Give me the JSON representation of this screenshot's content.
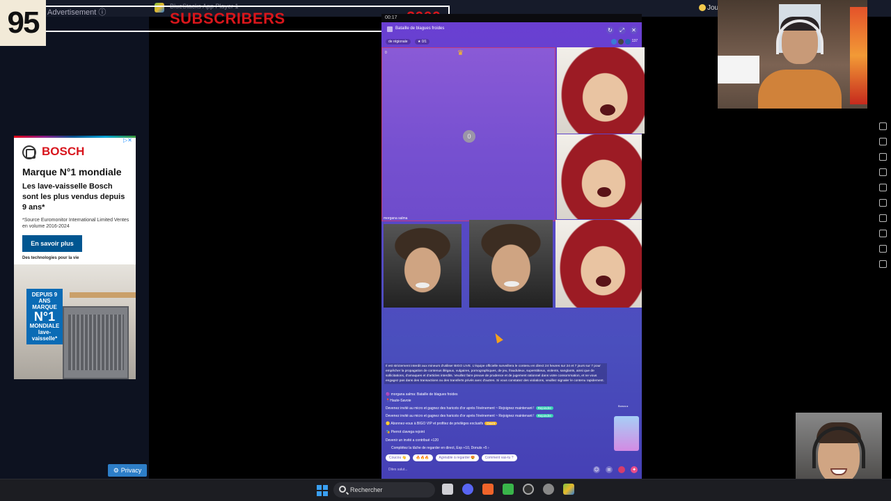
{
  "overlay": {
    "counter": "95",
    "advertisement_label": "Advertisement ⓘ",
    "subscribers_label": "SUBSCRIBERS",
    "subscribers_goal": "2000"
  },
  "topbar": {
    "bluestacks_title": "BlueStacks App Player 1",
    "right_label": "Jou"
  },
  "ad": {
    "brand": "BOSCH",
    "headline": "Marque N°1 mondiale",
    "body": "Les lave-vaisselle Bosch sont les plus vendus depuis 9 ans*",
    "footnote": "*Source Euromonitor International Limited Ventes en volume 2016-2024",
    "cta": "En savoir plus",
    "tagline": "Des technologies pour la vie",
    "badge_top": "DEPUIS 9 ANS MARQUE",
    "badge_big": "N°1",
    "badge_bottom": "MONDIALE lave-vaisselle*",
    "privacy": "Privacy"
  },
  "app": {
    "time": "00:17",
    "room_title": "Bataille de blagues froides",
    "tag_region": "de régionale",
    "tag_seats": "0/1",
    "viewer_count": "137",
    "score": "0",
    "seat_number": "0",
    "host_name": "morgana salma",
    "notice": "Il est strictement interdit aux mineurs d'utiliser BIGO LIVE. L'équipe officielle surveillera le contenu en direct 24 heures sur 24 et 7 jours sur 7 pour empêcher la propagation de contenus illégaux, vulgaires, pornographiques, de jeu, frauduleux, superstitieux, violents, sanglants, ainsi que de sollicitations, d'arnaques et d'articles interdits. Veuillez faire preuve de prudence et de jugement rationnel dans votre consommation, et ne vous engagez pas dans des transactions ou des transferts privés avec d'autres. Si vous constatez des violations, veuillez signaler le contenu rapidement.",
    "chat": [
      "morgana salma: Bataille de blagues froides",
      "Haute-Savoie",
      "Devenez invité au micro et gagnez des haricots d'or après l'événement ~ Rejoignez maintenant !",
      "Devenez invité au micro et gagnez des haricots d'or après l'événement ~ Rejoignez maintenant !",
      "Abonnez-vous à BIGO VIP et profitez de privilèges exclusifs",
      "Pierrot clavega rejoint",
      "Devenir un invité a contribué +120",
      "Complétez la tâche de regarder en direct, Exp +10, Donuts +5"
    ],
    "quick_replies": [
      "Coucou 👋",
      "🔥🔥🔥",
      "Agréable à regarder 😍",
      "Comment vas-tu ?"
    ],
    "input_placeholder": "Dites salut..."
  },
  "taskbar": {
    "search_label": "Rechercher"
  },
  "colors": {
    "app_purple": "#6a3fd2",
    "subscribers_red": "#d8161b",
    "bosch_red": "#d8151d",
    "bosch_blue": "#005691",
    "accent_teal": "#3ad0b4"
  }
}
